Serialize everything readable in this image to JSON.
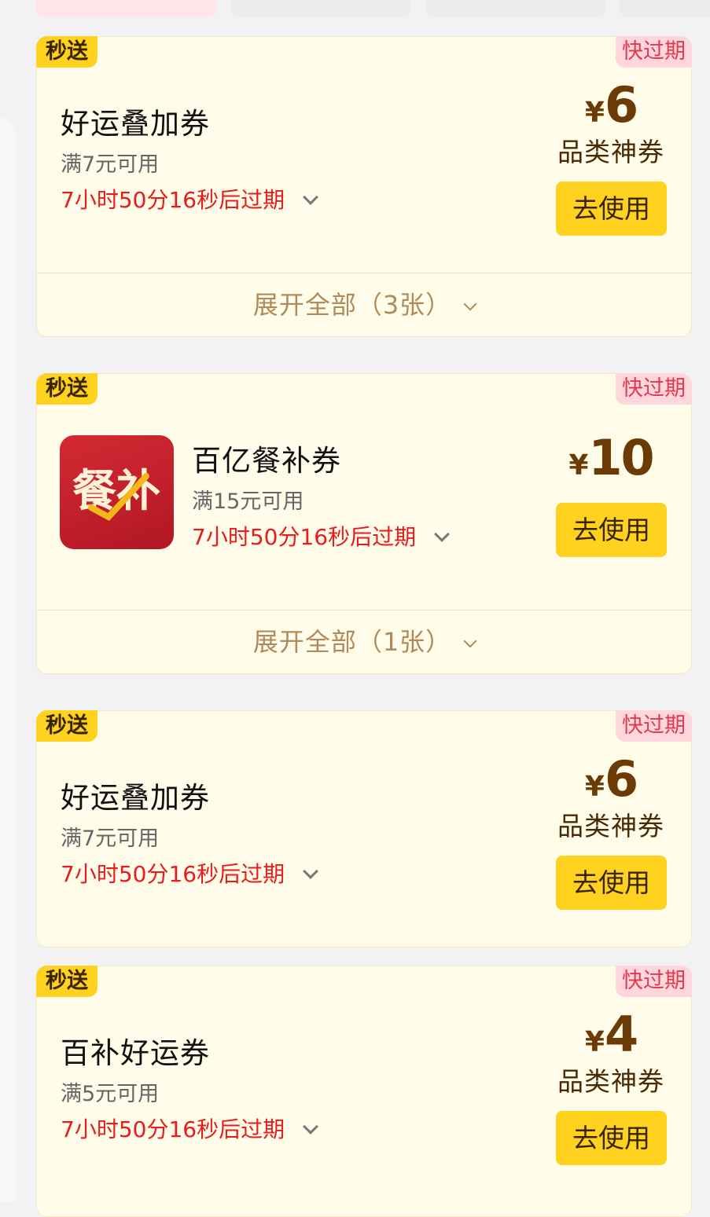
{
  "coupons": [
    {
      "tag_fast": "秒送",
      "tag_expire": "快过期",
      "title": "好运叠加券",
      "condition": "满7元可用",
      "expire": "7小时50分16秒后过期",
      "yen": "¥",
      "amount": "6",
      "type": "品类神券",
      "button": "去使用",
      "footer": "展开全部（3张）"
    },
    {
      "tag_fast": "秒送",
      "tag_expire": "快过期",
      "title": "百亿餐补券",
      "condition": "满15元可用",
      "expire": "7小时50分16秒后过期",
      "yen": "¥",
      "amount": "10",
      "button": "去使用",
      "footer": "展开全部（1张）",
      "logo_text": "餐补"
    },
    {
      "tag_fast": "秒送",
      "tag_expire": "快过期",
      "title": "好运叠加券",
      "condition": "满7元可用",
      "expire": "7小时50分16秒后过期",
      "yen": "¥",
      "amount": "6",
      "type": "品类神券",
      "button": "去使用"
    },
    {
      "tag_fast": "秒送",
      "tag_expire": "快过期",
      "title": "百补好运券",
      "condition": "满5元可用",
      "expire": "7小时50分16秒后过期",
      "yen": "¥",
      "amount": "4",
      "type": "品类神券",
      "button": "去使用"
    }
  ],
  "colors": {
    "accent_yellow": "#ffd21f",
    "card_bg": "#fffcea",
    "expire_red": "#e81c1c",
    "price_brown": "#6b3a05",
    "expire_tag_bg": "#ffd6dc"
  }
}
